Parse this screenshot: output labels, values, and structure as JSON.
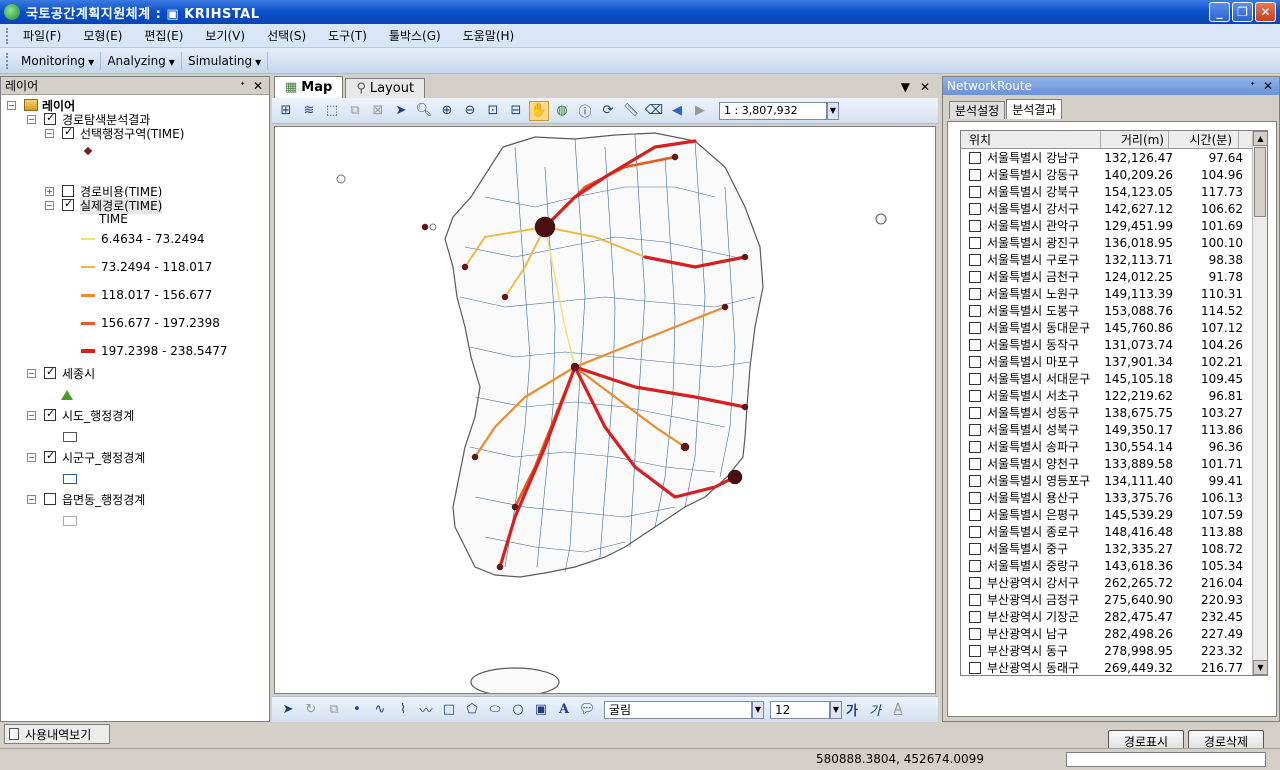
{
  "window": {
    "title": "국토공간계획지원체계 : ▣ KRIHSTAL"
  },
  "menu": [
    "파일(F)",
    "모형(E)",
    "편집(E)",
    "보기(V)",
    "선택(S)",
    "도구(T)",
    "툴박스(G)",
    "도움말(H)"
  ],
  "toolbar": {
    "items": [
      "Monitoring",
      "Analyzing",
      "Simulating"
    ]
  },
  "layers_panel": {
    "title": "레이어",
    "root": "레이어",
    "group": "경로탐색분석결과",
    "sub1": "선택행정구역(TIME)",
    "sub2": "경로비용(TIME)",
    "sub3": "실제경로(TIME)",
    "field": "TIME",
    "legend": [
      {
        "label": "6.4634 - 73.2494",
        "color": "#f2e07a"
      },
      {
        "label": "73.2494 - 118.017",
        "color": "#f0b63a"
      },
      {
        "label": "118.017 - 156.677",
        "color": "#ee8a2a"
      },
      {
        "label": "156.677 - 197.2398",
        "color": "#e65a24"
      },
      {
        "label": "197.2398 - 238.5477",
        "color": "#d42020"
      }
    ],
    "layer_sejong": "세종시",
    "layer_sido": "시도_행정경계",
    "layer_sigungu": "시군구_행정경계",
    "layer_eupmyeon": "읍면동_행정경계"
  },
  "map_view": {
    "tabs": [
      "Map",
      "Layout"
    ],
    "scale": "1 : 3,807,932",
    "font": "굴림",
    "font_size": "12",
    "bold_glyph": "가",
    "italic_glyph": "가"
  },
  "route_panel": {
    "title": "NetworkRoute",
    "tabs": [
      "분석설정",
      "분석결과"
    ],
    "columns": [
      "위치",
      "거리(m)",
      "시간(분)"
    ],
    "rows": [
      [
        "서울특별시 강남구",
        "132,126.47",
        "97.64"
      ],
      [
        "서울특별시 강동구",
        "140,209.26",
        "104.96"
      ],
      [
        "서울특별시 강북구",
        "154,123.05",
        "117.73"
      ],
      [
        "서울특별시 강서구",
        "142,627.12",
        "106.62"
      ],
      [
        "서울특별시 관악구",
        "129,451.99",
        "101.69"
      ],
      [
        "서울특별시 광진구",
        "136,018.95",
        "100.10"
      ],
      [
        "서울특별시 구로구",
        "132,113.71",
        "98.38"
      ],
      [
        "서울특별시 금천구",
        "124,012.25",
        "91.78"
      ],
      [
        "서울특별시 노원구",
        "149,113.39",
        "110.31"
      ],
      [
        "서울특별시 도봉구",
        "153,088.76",
        "114.52"
      ],
      [
        "서울특별시 동대문구",
        "145,760.86",
        "107.12"
      ],
      [
        "서울특별시 동작구",
        "131,073.74",
        "104.26"
      ],
      [
        "서울특별시 마포구",
        "137,901.34",
        "102.21"
      ],
      [
        "서울특별시 서대문구",
        "145,105.18",
        "109.45"
      ],
      [
        "서울특별시 서초구",
        "122,219.62",
        "96.81"
      ],
      [
        "서울특별시 성동구",
        "138,675.75",
        "103.27"
      ],
      [
        "서울특별시 성북구",
        "149,350.17",
        "113.86"
      ],
      [
        "서울특별시 송파구",
        "130,554.14",
        "96.36"
      ],
      [
        "서울특별시 양천구",
        "133,889.58",
        "101.71"
      ],
      [
        "서울특별시 영등포구",
        "134,111.40",
        "99.41"
      ],
      [
        "서울특별시 용산구",
        "133,375.76",
        "106.13"
      ],
      [
        "서울특별시 은평구",
        "145,539.29",
        "107.59"
      ],
      [
        "서울특별시 종로구",
        "148,416.48",
        "113.88"
      ],
      [
        "서울특별시 중구",
        "132,335.27",
        "108.72"
      ],
      [
        "서울특별시 중랑구",
        "143,618.36",
        "105.34"
      ],
      [
        "부산광역시 강서구",
        "262,265.72",
        "216.04"
      ],
      [
        "부산광역시 금정구",
        "275,640.90",
        "220.93"
      ],
      [
        "부산광역시 기장군",
        "282,475.47",
        "232.45"
      ],
      [
        "부산광역시 남구",
        "282,498.26",
        "227.49"
      ],
      [
        "부산광역시 동구",
        "278,998.95",
        "223.32"
      ],
      [
        "부산광역시 동래구",
        "269,449.32",
        "216.77"
      ]
    ],
    "btn_show": "경로표시",
    "btn_delete": "경로삭제"
  },
  "bottom": {
    "tab": "사용내역보기"
  },
  "status": {
    "coords": "580888.3804, 452674.0099"
  }
}
